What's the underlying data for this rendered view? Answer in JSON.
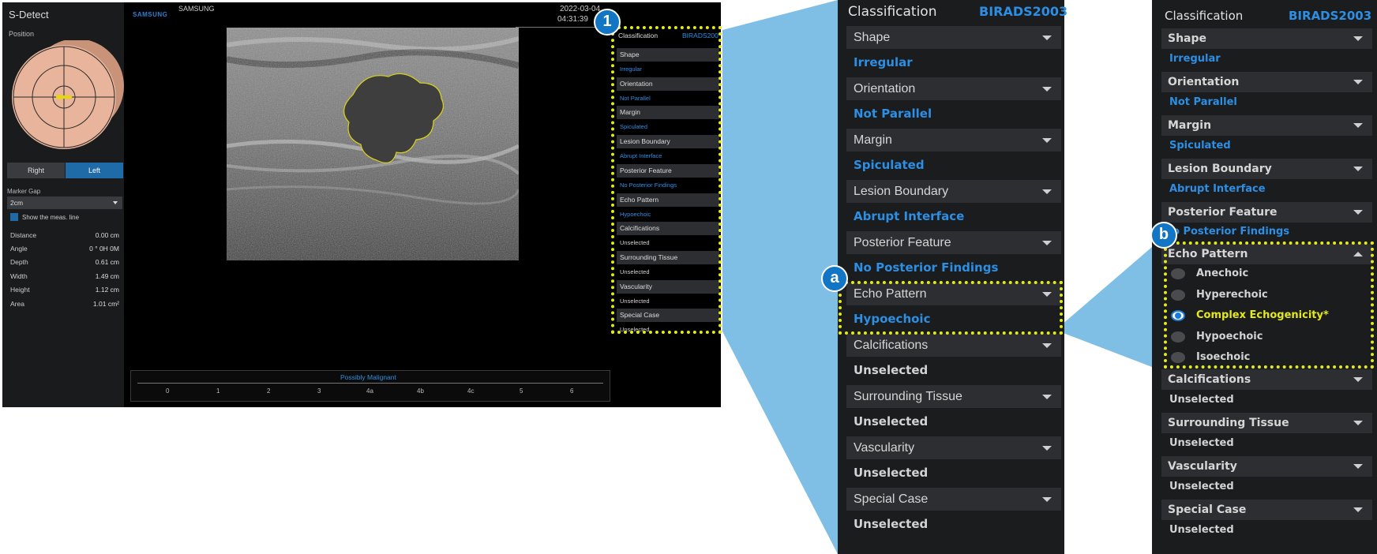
{
  "screen": {
    "app_title": "S-Detect",
    "position_label": "Position",
    "right_button": "Right",
    "left_button": "Left",
    "marker_gap_label": "Marker Gap",
    "marker_gap_value": "2cm",
    "show_meas_line": "Show the meas. line",
    "measurements": [
      {
        "label": "Distance",
        "value": "0.00 cm"
      },
      {
        "label": "Angle",
        "value": "0 ° 0H 0M"
      },
      {
        "label": "Depth",
        "value": "0.61 cm"
      },
      {
        "label": "Width",
        "value": "1.49 cm"
      },
      {
        "label": "Height",
        "value": "1.12 cm"
      },
      {
        "label": "Area",
        "value": "1.01 cm²"
      }
    ],
    "brand_logo": "SAMSUNG",
    "brand_text": "SAMSUNG",
    "date": "2022-03-04",
    "time": "04:31:39",
    "assessment": "Possibly Malignant",
    "scale_ticks": [
      "0",
      "1",
      "2",
      "3",
      "4a",
      "4b",
      "4c",
      "5",
      "6"
    ]
  },
  "classification": {
    "title": "Classification",
    "standard": "BIRADS2003",
    "standard_truncated": "BIRADS200",
    "items": [
      {
        "label": "Shape",
        "value": "Irregular",
        "set": true
      },
      {
        "label": "Orientation",
        "value": "Not Parallel",
        "set": true
      },
      {
        "label": "Margin",
        "value": "Spiculated",
        "set": true
      },
      {
        "label": "Lesion Boundary",
        "value": "Abrupt Interface",
        "set": true
      },
      {
        "label": "Posterior Feature",
        "value": "No Posterior Findings",
        "set": true
      },
      {
        "label": "Echo Pattern",
        "value": "Hypoechoic",
        "set": true
      },
      {
        "label": "Calcifications",
        "value": "Unselected",
        "set": false
      },
      {
        "label": "Surrounding Tissue",
        "value": "Unselected",
        "set": false
      },
      {
        "label": "Vascularity",
        "value": "Unselected",
        "set": false
      },
      {
        "label": "Special Case",
        "value": "Unselected",
        "set": false
      }
    ],
    "echo_options": [
      "Anechoic",
      "Hyperechoic",
      "Complex Echogenicity*",
      "Hypoechoic",
      "Isoechoic"
    ],
    "echo_selected": "Complex Echogenicity*",
    "panel_b_partial_value": "o Posterior Findings"
  },
  "badges": {
    "one": "1",
    "a": "a",
    "b": "b"
  },
  "colors": {
    "accent_blue": "#2c8fe4",
    "highlight_yellow": "#e4e91c",
    "callout_blue": "#7fbfe6",
    "panel_bg": "#1b1c1e",
    "header_bg": "#2d2e31"
  }
}
